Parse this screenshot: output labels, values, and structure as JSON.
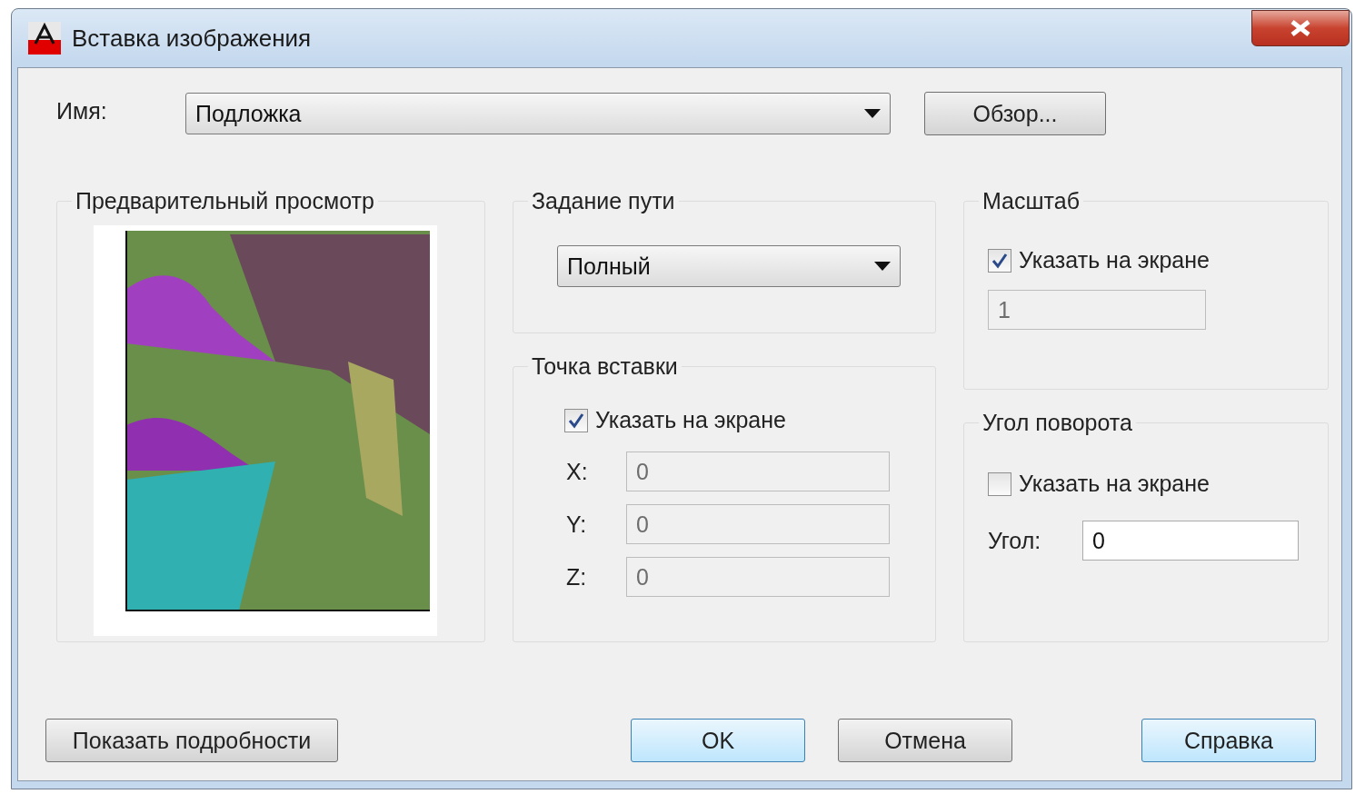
{
  "window": {
    "title": "Вставка изображения"
  },
  "name": {
    "label": "Имя:",
    "value": "Подложка"
  },
  "browse_button": "Обзор...",
  "preview": {
    "title": "Предварительный просмотр"
  },
  "path": {
    "title": "Задание пути",
    "value": "Полный"
  },
  "insertion_point": {
    "title": "Точка вставки",
    "specify": {
      "label": "Указать на экране",
      "checked": true
    },
    "fields": [
      {
        "label": "X:",
        "value": "0",
        "disabled": true
      },
      {
        "label": "Y:",
        "value": "0",
        "disabled": true
      },
      {
        "label": "Z:",
        "value": "0",
        "disabled": true
      }
    ]
  },
  "scale": {
    "title": "Масштаб",
    "specify": {
      "label": "Указать на экране",
      "checked": true
    },
    "value": "1",
    "disabled": true
  },
  "rotation": {
    "title": "Угол поворота",
    "specify": {
      "label": "Указать на экране",
      "checked": false
    },
    "angle_label": "Угол:",
    "angle": "0",
    "disabled": false
  },
  "details_button": {
    "label": "Показать подробности",
    "highlighted": false
  },
  "buttons": [
    {
      "label": "OK",
      "highlighted": true
    },
    {
      "label": "Отмена",
      "highlighted": false
    },
    {
      "label": "Справка",
      "highlighted": true
    }
  ]
}
